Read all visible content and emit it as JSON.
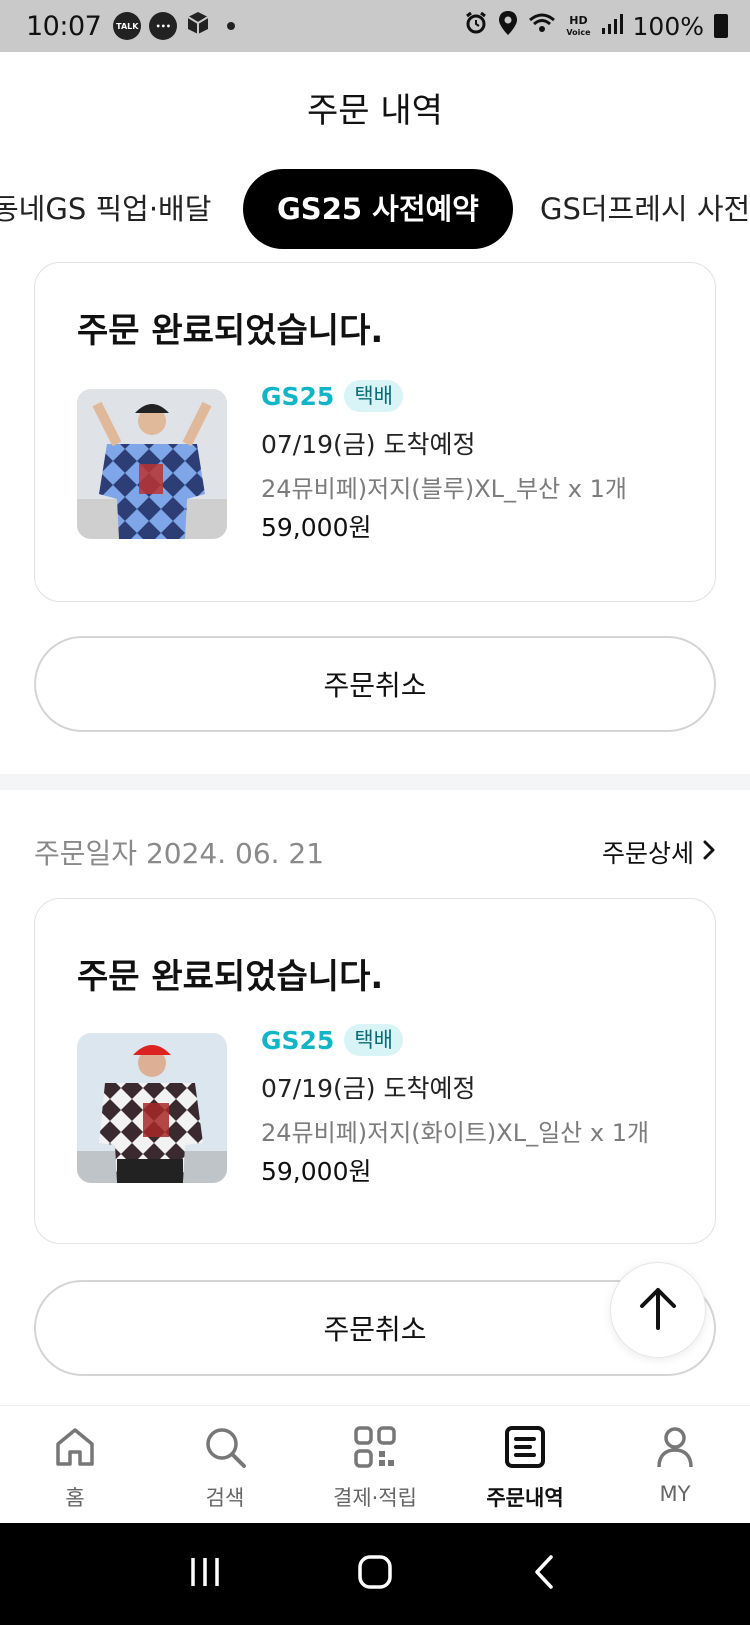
{
  "status_bar": {
    "time": "10:07",
    "talk_label": "TALK",
    "hd_label": "HD",
    "voice_label": "Voice",
    "battery": "100%"
  },
  "header": {
    "title": "주문 내역"
  },
  "tabs": [
    {
      "label": "동네GS 픽업·배달"
    },
    {
      "label": "GS25 사전예약"
    },
    {
      "label": "GS더프레시 사전"
    }
  ],
  "orders": [
    {
      "date": "",
      "status": "주문 완료되었습니다.",
      "brand": "GS25",
      "badge": "택배",
      "eta": "07/19(금) 도착예정",
      "product": "24뮤비페)저지(블루)XL_부산 x 1개",
      "price": "59,000원",
      "cancel_label": "주문취소"
    },
    {
      "date": "주문일자 2024. 06. 21",
      "detail_label": "주문상세",
      "status": "주문 완료되었습니다.",
      "brand": "GS25",
      "badge": "택배",
      "eta": "07/19(금) 도착예정",
      "product": "24뮤비페)저지(화이트)XL_일산 x 1개",
      "price": "59,000원",
      "cancel_label": "주문취소"
    }
  ],
  "bottom_nav": [
    {
      "label": "홈",
      "icon": "home-icon"
    },
    {
      "label": "검색",
      "icon": "search-icon"
    },
    {
      "label": "결제·적립",
      "icon": "grid-qr-icon"
    },
    {
      "label": "주문내역",
      "icon": "order-list-icon",
      "active": true
    },
    {
      "label": "MY",
      "icon": "person-icon"
    }
  ],
  "colors": {
    "accent": "#12b5c7",
    "badge_bg": "#d8f4f7",
    "active_tab": "#000000"
  }
}
